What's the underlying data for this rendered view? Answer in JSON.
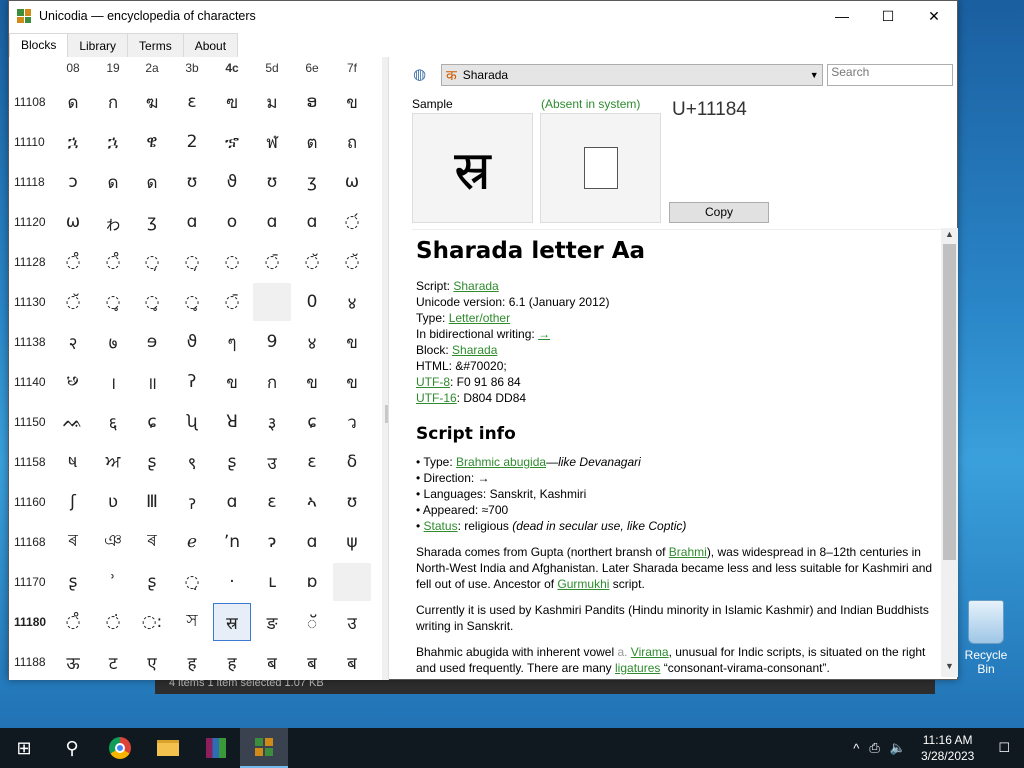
{
  "window": {
    "title": "Unicodia — encyclopedia of characters",
    "minimize": "—",
    "maximize": "☐",
    "close": "✕"
  },
  "tabs": [
    {
      "label": "Blocks",
      "active": true
    },
    {
      "label": "Library"
    },
    {
      "label": "Terms"
    },
    {
      "label": "About"
    }
  ],
  "grid": {
    "columns": [
      "08",
      "19",
      "2a",
      "3b",
      "4c",
      "5d",
      "6e",
      "7f"
    ],
    "bold_column": 4,
    "rows": [
      {
        "label": "11108",
        "cells": [
          "ด",
          "ก",
          "ฆ",
          "ε",
          "ฃ",
          "ม",
          "ອ",
          "ข"
        ]
      },
      {
        "label": "11110",
        "cells": [
          "ኋ",
          "ኋ",
          "ዌ",
          "2",
          "ኇ",
          "ฬ",
          "ต",
          "ถ"
        ]
      },
      {
        "label": "11118",
        "cells": [
          "ɔ",
          "ด",
          "ด",
          "ʊ",
          "ϑ",
          "ʊ",
          "ʒ",
          "ω"
        ]
      },
      {
        "label": "11120",
        "cells": [
          "ω",
          "ゎ",
          "ʒ",
          "ɑ",
          "o",
          "ɑ",
          "ɑ",
          "◌́"
        ]
      },
      {
        "label": "11128",
        "cells": [
          "◌̊",
          "◌̊",
          "◌̦",
          "◌̦",
          "◌",
          "◌̄",
          "◌̆",
          "◌̆"
        ]
      },
      {
        "label": "11130",
        "cells": [
          "◌̆",
          "◌̥",
          "◌̥",
          "◌̥",
          "◌̄",
          "",
          "0",
          "४"
        ]
      },
      {
        "label": "11138",
        "cells": [
          "२",
          "७",
          "ɘ",
          "ϑ",
          "ๆ",
          "9",
          "४",
          "ข"
        ]
      },
      {
        "label": "11140",
        "cells": [
          "꣸",
          "।",
          "॥",
          "ʔ",
          "ข",
          "ก",
          "ข",
          "ข"
        ]
      },
      {
        "label": "11150",
        "cells": [
          "ᨕ",
          "६",
          "ɕ",
          "ʯ",
          "ꓤ",
          "३",
          "ɕ",
          "ว"
        ]
      },
      {
        "label": "11158",
        "cells": [
          "ષ",
          "ਅ",
          "ʂ",
          "९",
          "ʂ",
          "उ",
          "ε",
          "δ"
        ]
      },
      {
        "label": "11160",
        "cells": [
          "ʃ",
          "ʋ",
          "Ⅲ",
          "ॽ",
          "ɑ",
          "ɛ",
          "ኣ",
          "ʊ"
        ]
      },
      {
        "label": "11168",
        "cells": [
          "ৰ",
          "ঞ",
          "ৰ",
          "ℯ",
          "ʼn",
          "ɂ",
          "ɑ",
          "ψ"
        ]
      },
      {
        "label": "11170",
        "cells": [
          "ʂ",
          "ʾ",
          "ʂ",
          "◌̣",
          "·",
          "ւ",
          "ɒ",
          ""
        ]
      },
      {
        "label": "11180",
        "bold": true,
        "cells": [
          "◌̊",
          "◌̇",
          "◌:",
          "স",
          "स्र",
          "ङ",
          "ॅ",
          "उ"
        ]
      },
      {
        "label": "11188",
        "cells": [
          "ऊ",
          "ट",
          "ए",
          "ह",
          "ह",
          "ब",
          "ब",
          "ब"
        ]
      }
    ],
    "selected": {
      "row": 13,
      "col": 4
    },
    "empty_cells": [
      {
        "row": 5,
        "col": 5
      },
      {
        "row": 12,
        "col": 7
      }
    ]
  },
  "toolbar": {
    "block_glyph": "क",
    "block_name": "Sharada",
    "search_placeholder": "Search"
  },
  "sample": {
    "label": "Sample",
    "absent_label": "(Absent in system)",
    "code": "U+11184",
    "glyph": "स्र",
    "copy_label": "Copy"
  },
  "info": {
    "title": "Sharada letter Aa",
    "props": [
      {
        "key": "Script: ",
        "link": "Sharada",
        "rest": ""
      },
      {
        "key": "Unicode version: 6.1 (January 2012)",
        "link": "",
        "rest": ""
      },
      {
        "key": "Type: ",
        "link": "Letter/other",
        "rest": ""
      },
      {
        "key": "In bidirectional writing: ",
        "link": "→",
        "rest": ""
      },
      {
        "key": "Block: ",
        "link": "Sharada",
        "rest": ""
      },
      {
        "key": "HTML: &#70020;",
        "link": "",
        "rest": ""
      },
      {
        "key": "",
        "link": "UTF-8",
        "rest": ": F0 91 86 84"
      },
      {
        "key": "",
        "link": "UTF-16",
        "rest": ": D804 DD84"
      }
    ],
    "script_title": "Script info",
    "script_props": {
      "type_pre": "• Type: ",
      "type_link": "Brahmic abugida",
      "type_post": "—",
      "type_ital": "like Devanagari",
      "direction": "• Direction: →",
      "languages": "• Languages: Sanskrit, Kashmiri",
      "appeared": "• Appeared: ≈700",
      "status_pre": "• ",
      "status_link": "Status",
      "status_post": ": religious ",
      "status_ital": "(dead in secular use, like Coptic)"
    },
    "para1_a": "Sharada comes from Gupta (northert bransh of ",
    "para1_link1": "Brahmi",
    "para1_b": "), was widespread in 8–12th centuries in North-West India and Afghanistan. Later Sharada became less and less suitable for Kashmiri and fell out of use. Ancestor of ",
    "para1_link2": "Gurmukhi",
    "para1_c": " script.",
    "para2": "Currently it is used by Kashmiri Pandits (Hindu minority in Islamic Kashmir) and Indian Buddhists writing in Sanskrit.",
    "para3_a": "Bhahmic abugida with inherent vowel ",
    "para3_b": "a. ",
    "para3_link": "Virama",
    "para3_c": ", unusual for Indic scripts, is situated on the right and used frequently. There are many ",
    "para3_link2": "ligatures",
    "para3_d": " “consonant-virama-consonant”."
  },
  "background_window": {
    "status": "4 items    1 item selected  1.07 KB"
  },
  "desktop": {
    "recycle_bin": "Recycle Bin"
  },
  "taskbar": {
    "start": "⊞",
    "search": "⚲",
    "time": "11:16 AM",
    "date": "3/28/2023",
    "tray_up": "^",
    "tray_net": "⎙",
    "tray_vol": "🔈",
    "notif": "☐"
  }
}
